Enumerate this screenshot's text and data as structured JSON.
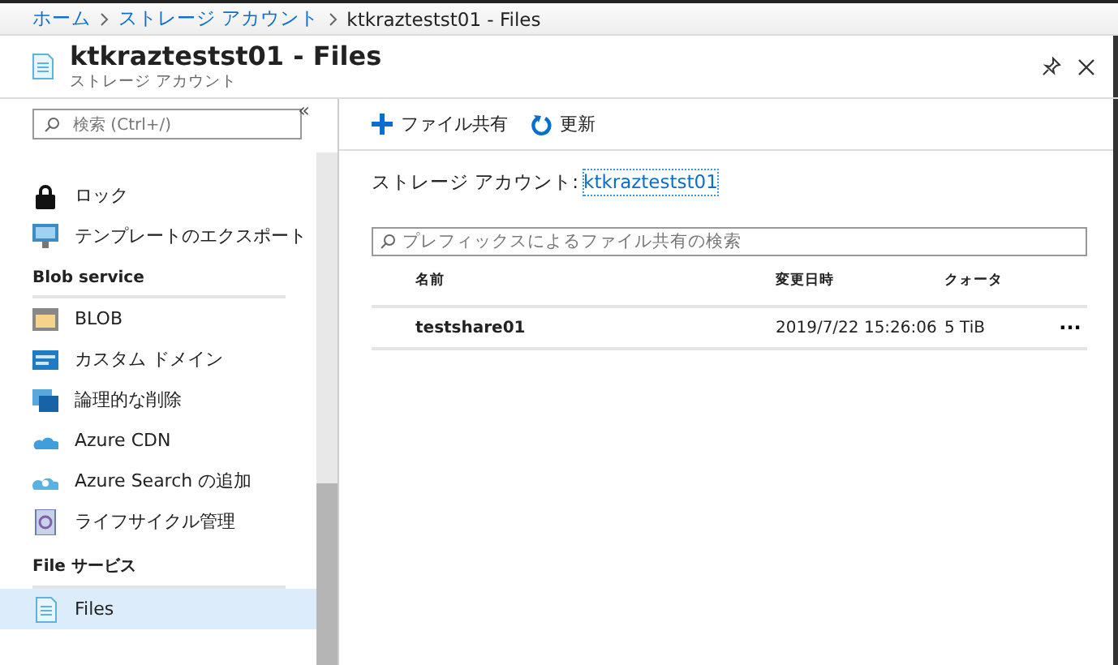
{
  "breadcrumb": [
    {
      "label": "ホーム",
      "link": true
    },
    {
      "label": "ストレージ アカウント",
      "link": true
    },
    {
      "label": "ktkraztestst01 - Files",
      "link": false
    }
  ],
  "header": {
    "title": "ktkraztestst01 - Files",
    "subtitle": "ストレージ アカウント"
  },
  "sidebar": {
    "search": {
      "placeholder": "検索 (Ctrl+/)"
    },
    "collapse": "«",
    "groups": [
      {
        "items": [
          {
            "kind": "lock",
            "label": "ロック",
            "selected": false
          },
          {
            "kind": "export",
            "label": "テンプレートのエクスポート",
            "selected": false
          }
        ]
      },
      {
        "heading": "Blob service",
        "items": [
          {
            "kind": "blob",
            "label": "BLOB",
            "selected": false
          },
          {
            "kind": "domain",
            "label": "カスタム ドメイン",
            "selected": false
          },
          {
            "kind": "softdelete",
            "label": "論理的な削除",
            "selected": false
          },
          {
            "kind": "cdn",
            "label": "Azure CDN",
            "selected": false
          },
          {
            "kind": "cloudsearch",
            "label": "Azure Search の追加",
            "selected": false
          },
          {
            "kind": "lifecycle",
            "label": "ライフサイクル管理",
            "selected": false
          }
        ]
      },
      {
        "heading": "File サービス",
        "items": [
          {
            "kind": "files",
            "label": "Files",
            "selected": true
          }
        ]
      }
    ]
  },
  "toolbar": [
    {
      "kind": "add",
      "label": "ファイル共有"
    },
    {
      "kind": "refresh",
      "label": "更新"
    }
  ],
  "account": {
    "label": "ストレージ アカウント:",
    "link": "ktkraztestst01"
  },
  "filter": {
    "placeholder": "プレフィックスによるファイル共有の検索"
  },
  "table": {
    "columns": [
      "名前",
      "変更日時",
      "クォータ"
    ],
    "rows": [
      {
        "name": "testshare01",
        "modified": "2019/7/22 15:26:06",
        "quota": "5 TiB",
        "more": "..."
      }
    ]
  }
}
